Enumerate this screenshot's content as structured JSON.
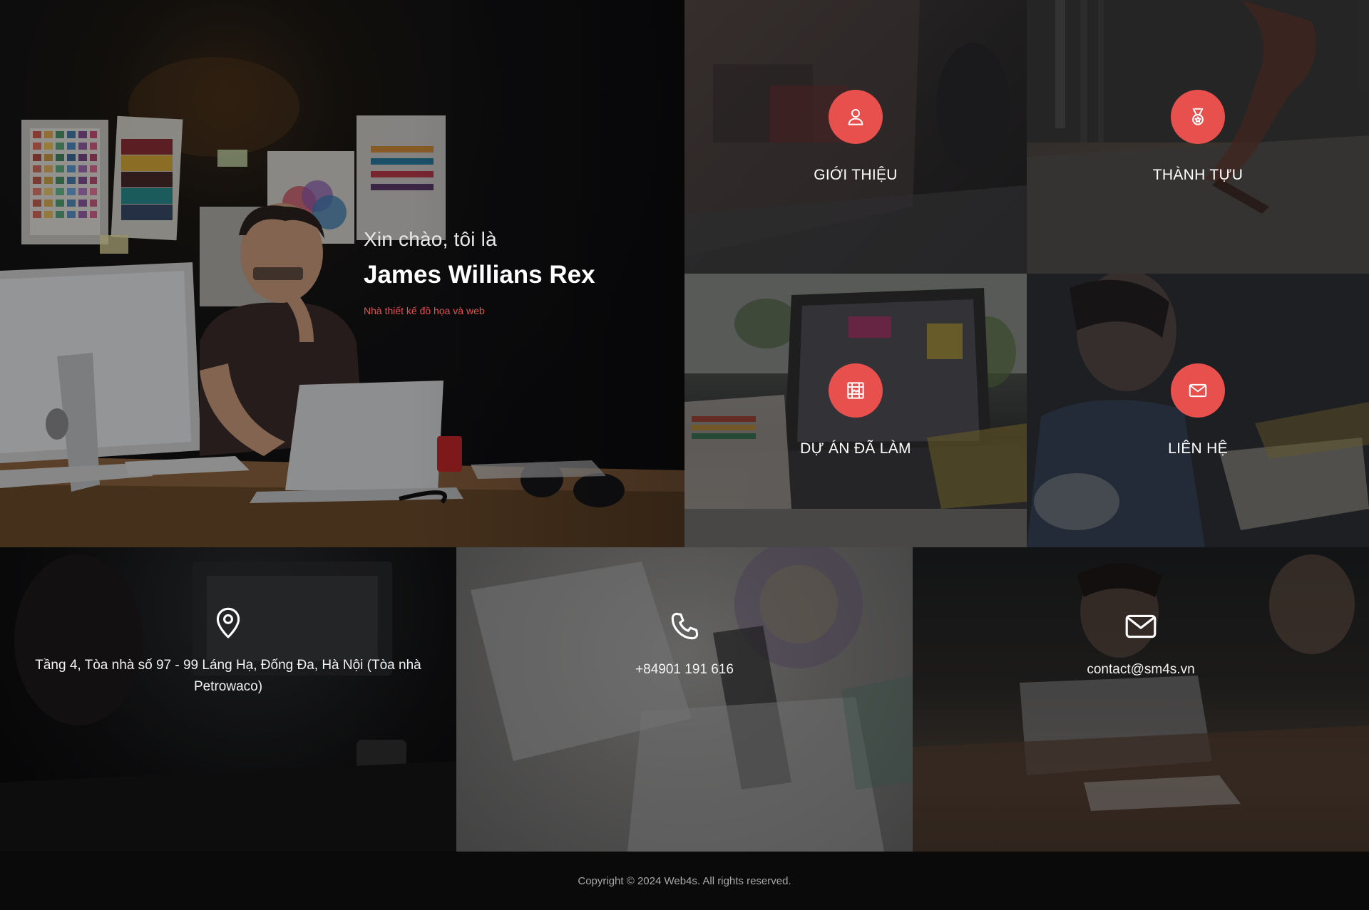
{
  "hero": {
    "greeting": "Xin chào, tôi là",
    "name": "James Willians Rex",
    "role": "Nhà thiết kế đồ họa và web"
  },
  "tiles": [
    {
      "id": "about",
      "label": "GIỚI THIỆU",
      "icon": "user-icon"
    },
    {
      "id": "awards",
      "label": "THÀNH TỰU",
      "icon": "medal-icon"
    },
    {
      "id": "projects",
      "label": "DỰ ÁN ĐÃ LÀM",
      "icon": "portfolio-icon"
    },
    {
      "id": "contact",
      "label": "LIÊN HỆ",
      "icon": "envelope-icon"
    }
  ],
  "info": {
    "address": "Tầng 4, Tòa nhà số 97 - 99 Láng Hạ, Đống Đa, Hà Nội (Tòa nhà Petrowaco)",
    "phone": "+84901 191 616",
    "email": "contact@sm4s.vn"
  },
  "footer": {
    "copyright": "Copyright © 2024 Web4s. All rights reserved."
  },
  "colors": {
    "accent": "#e8504e",
    "role_text": "#e5504e",
    "footer_bg": "#0a0a0a"
  }
}
